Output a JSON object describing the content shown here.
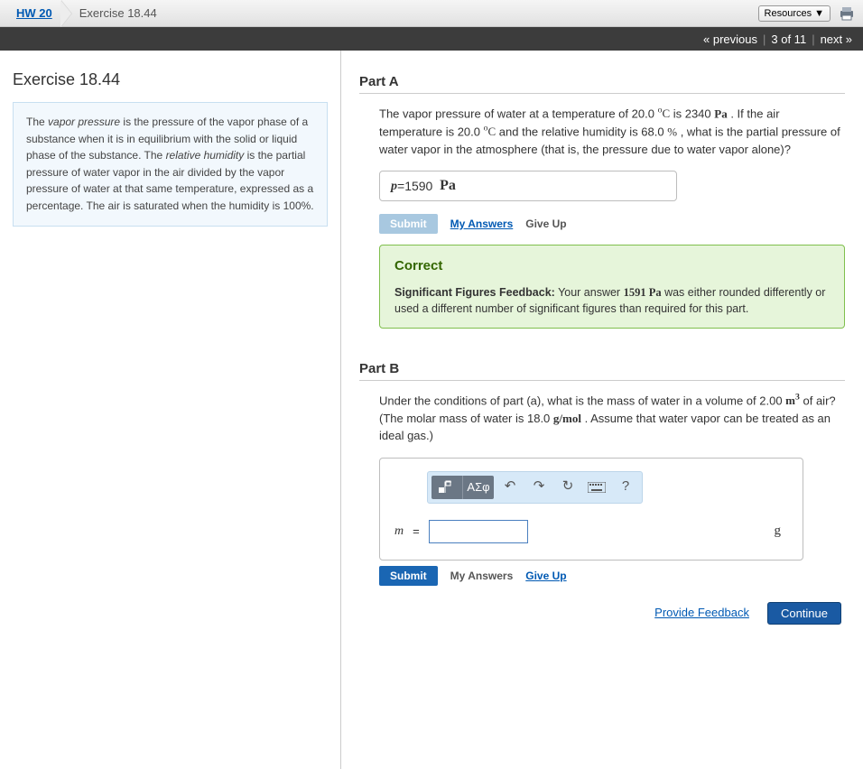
{
  "breadcrumb": {
    "hw": "HW 20",
    "exercise": "Exercise 18.44"
  },
  "topbar": {
    "resources": "Resources"
  },
  "nav": {
    "prev": "« previous",
    "position": "3 of 11",
    "next": "next »"
  },
  "left": {
    "title": "Exercise 18.44",
    "context_pre": "The ",
    "context_term1": "vapor pressure",
    "context_mid1": " is the pressure of the vapor phase of a substance when it is in equilibrium with the solid or liquid phase of the substance. The ",
    "context_term2": "relative humidity",
    "context_mid2": " is the partial pressure of water vapor in the air divided by the vapor pressure of water at that same temperature, expressed as a percentage. The air is saturated when the humidity is 100%."
  },
  "partA": {
    "header": "Part A",
    "q1": "The vapor pressure of water at a temperature of 20.0 ",
    "degC": "°C",
    "q2": " is 2340 ",
    "Pa": "Pa",
    "q3": " . If the air temperature is 20.0 ",
    "q4": " and the relative humidity is 68.0 ",
    "pct": "%",
    "q5": " , what is the partial pressure of water vapor in the atmosphere (that is, the pressure due to water vapor alone)?",
    "var": "p",
    "eq": " =  ",
    "val": "1590",
    "unit": "Pa",
    "submit": "Submit",
    "myans": "My Answers",
    "giveup": "Give Up",
    "correct": "Correct",
    "fb_label": "Significant Figures Feedback:",
    "fb_a": " Your answer ",
    "fb_val": "1591 Pa",
    "fb_b": " was either rounded differently or used a different number of significant figures than required for this part."
  },
  "partB": {
    "header": "Part B",
    "q1": "Under the conditions of part (a), what is the mass of water in a volume of 2.00 ",
    "m3": "m",
    "q2": " of air? (The molar mass of water is 18.0 ",
    "gmol": "g/mol",
    "q3": " . Assume that water vapor can be treated as an ideal gas.)",
    "var": "m",
    "eq": " = ",
    "unit": "g",
    "symbols": "ΑΣφ",
    "submit": "Submit",
    "myans": "My Answers",
    "giveup": "Give Up"
  },
  "footer": {
    "feedback": "Provide Feedback",
    "continue": "Continue"
  }
}
